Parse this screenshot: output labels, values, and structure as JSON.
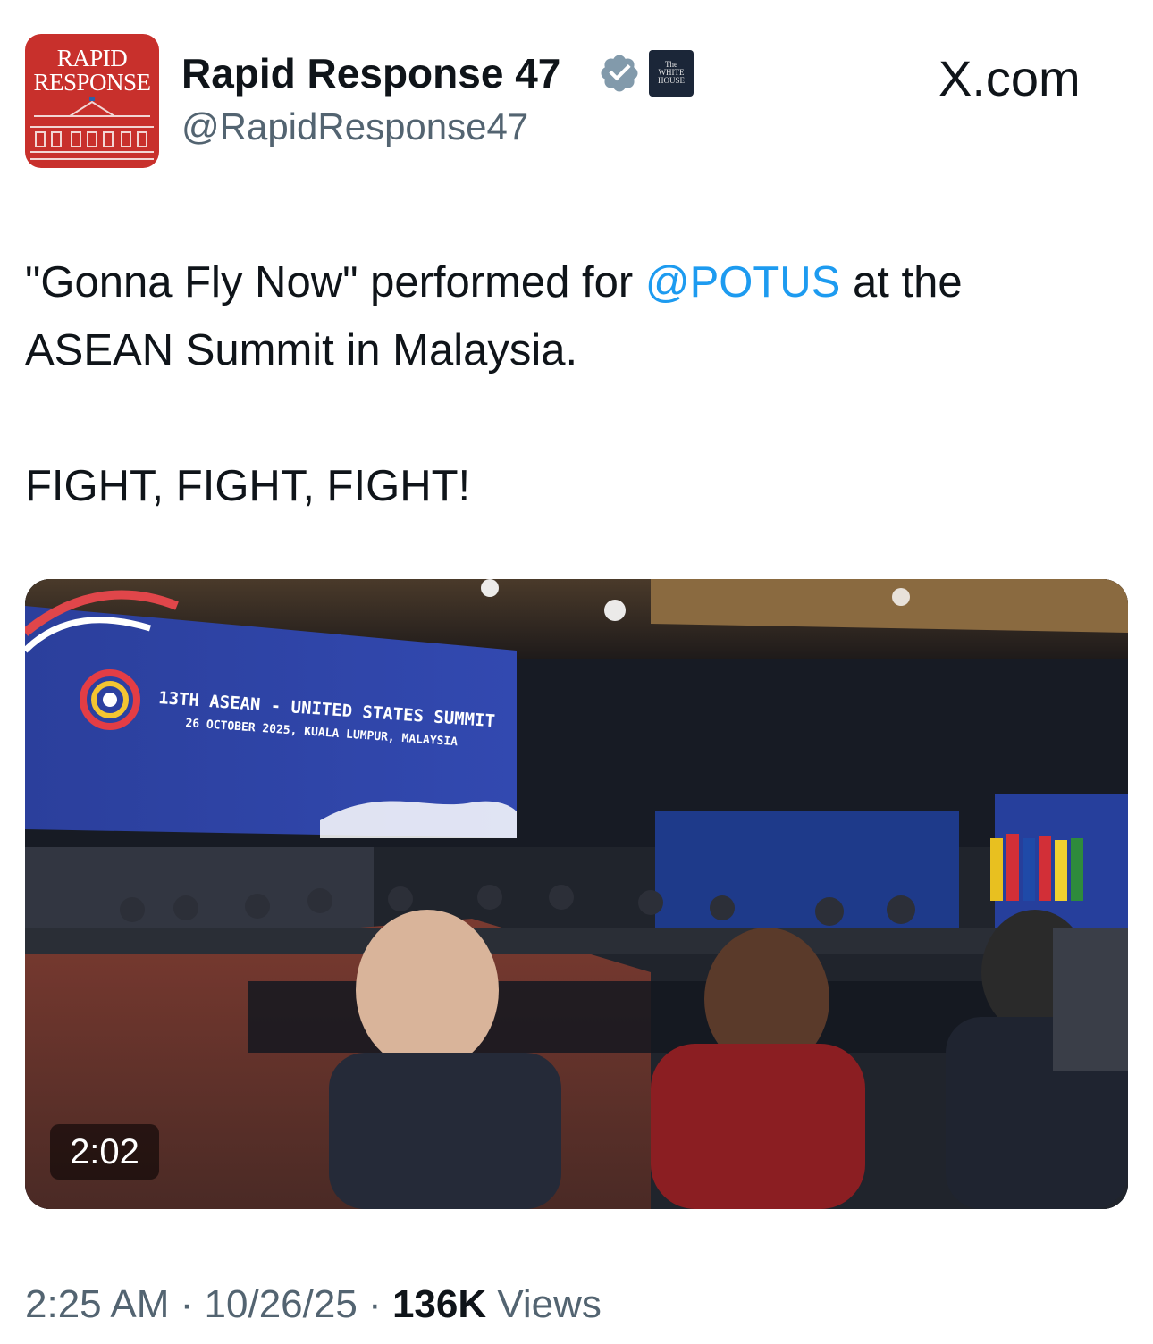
{
  "author": {
    "avatar_line1": "RAPID",
    "avatar_line2": "RESPONSE",
    "name": "Rapid Response 47",
    "handle": "@RapidResponse47",
    "affiliation_badge_line1": "The",
    "affiliation_badge_line2": "WHITE",
    "affiliation_badge_line3": "HOUSE"
  },
  "brand": "X.com",
  "tweet": {
    "line1_before": "\"Gonna Fly Now\" performed for ",
    "mention": "@POTUS",
    "line1_after": " at the",
    "line2": "ASEAN Summit in Malaysia.",
    "line3": "FIGHT, FIGHT, FIGHT!"
  },
  "media": {
    "duration": "2:02",
    "screen_title": "13TH ASEAN - UNITED STATES SUMMIT",
    "screen_subtitle": "26 OCTOBER 2025, KUALA LUMPUR, MALAYSIA"
  },
  "meta": {
    "time": "2:25 AM",
    "separator": " · ",
    "date": "10/26/25",
    "views_count": "136K",
    "views_label": " Views"
  },
  "colors": {
    "avatar_bg": "#c8302c",
    "mention": "#1d9bf0",
    "verified": "#829aab",
    "secondary_text": "#536471"
  }
}
